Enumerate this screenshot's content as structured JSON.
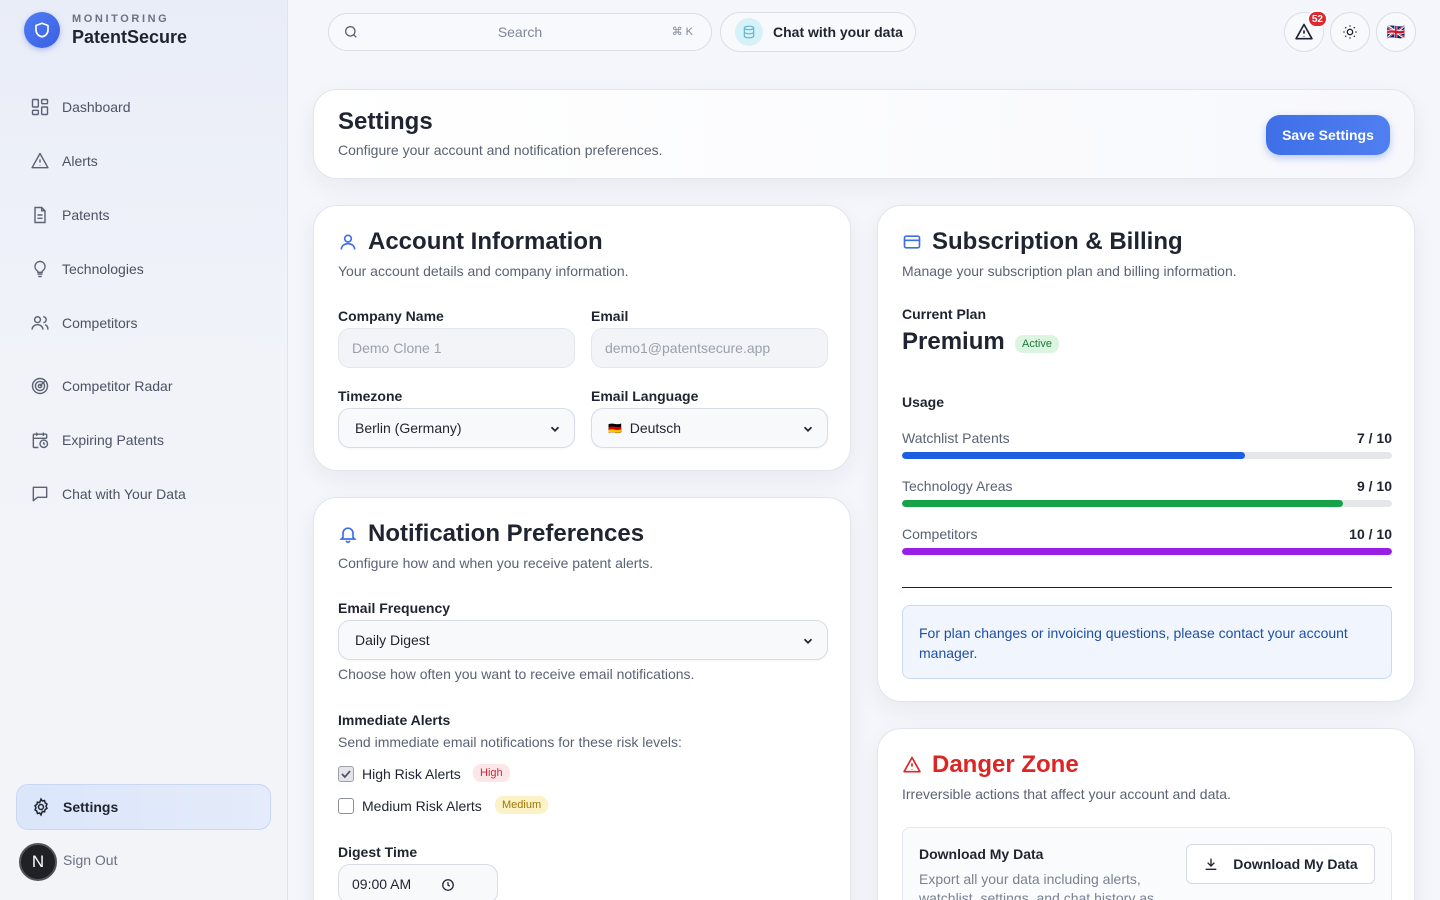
{
  "brand": {
    "subtitle": "MONITORING",
    "name": "PatentSecure"
  },
  "sidebar": {
    "items": [
      {
        "label": "Dashboard",
        "icon": "grid-icon"
      },
      {
        "label": "Alerts",
        "icon": "warning-icon"
      },
      {
        "label": "Patents",
        "icon": "document-icon"
      },
      {
        "label": "Technologies",
        "icon": "lightbulb-icon"
      },
      {
        "label": "Competitors",
        "icon": "users-icon"
      },
      {
        "label": "Competitor Radar",
        "icon": "radar-icon"
      },
      {
        "label": "Expiring Patents",
        "icon": "calendar-clock-icon"
      },
      {
        "label": "Chat with Your Data",
        "icon": "chat-icon"
      }
    ],
    "settings_label": "Settings",
    "avatar_letter": "N",
    "signout_label": "Sign Out"
  },
  "topbar": {
    "search_placeholder": "Search",
    "search_shortcut": "⌘ K",
    "chat_label": "Chat with your data",
    "alert_count": "52",
    "language_flag": "🇬🇧"
  },
  "header": {
    "title": "Settings",
    "subtitle": "Configure your account and notification preferences.",
    "save_label": "Save Settings"
  },
  "account": {
    "title": "Account Information",
    "subtitle": "Your account details and company information.",
    "company_label": "Company Name",
    "company_value": "Demo Clone 1",
    "email_label": "Email",
    "email_value": "demo1@patentsecure.app",
    "timezone_label": "Timezone",
    "timezone_value": "Berlin (Germany)",
    "language_label": "Email Language",
    "language_flag": "🇩🇪",
    "language_value": "Deutsch"
  },
  "notifications": {
    "title": "Notification Preferences",
    "subtitle": "Configure how and when you receive patent alerts.",
    "frequency_label": "Email Frequency",
    "frequency_value": "Daily Digest",
    "frequency_hint": "Choose how often you want to receive email notifications.",
    "immediate_label": "Immediate Alerts",
    "immediate_hint": "Send immediate email notifications for these risk levels:",
    "high_label": "High Risk Alerts",
    "high_pill": "High",
    "high_checked": true,
    "medium_label": "Medium Risk Alerts",
    "medium_pill": "Medium",
    "medium_checked": false,
    "digest_label": "Digest Time",
    "digest_value": "09:00 AM"
  },
  "billing": {
    "title": "Subscription & Billing",
    "subtitle": "Manage your subscription plan and billing information.",
    "current_plan_label": "Current Plan",
    "plan_name": "Premium",
    "plan_status": "Active",
    "usage_label": "Usage",
    "usage": [
      {
        "label": "Watchlist Patents",
        "value": "7 / 10",
        "used": 7,
        "limit": 10,
        "color": "#1d5fe0"
      },
      {
        "label": "Technology Areas",
        "value": "9 / 10",
        "used": 9,
        "limit": 10,
        "color": "#16a34a"
      },
      {
        "label": "Competitors",
        "value": "10 / 10",
        "used": 10,
        "limit": 10,
        "color": "#9b1ee6"
      }
    ],
    "info_text": "For plan changes or invoicing questions, please contact your account manager."
  },
  "danger": {
    "title": "Danger Zone",
    "subtitle": "Irreversible actions that affect your account and data.",
    "download_title": "Download My Data",
    "download_desc_1": "Export all your data including alerts,",
    "download_desc_2": "watchlist, settings, and chat history as",
    "download_button": "Download My Data"
  },
  "colors": {
    "accent": "#3f6fe8",
    "danger": "#dc2626"
  }
}
